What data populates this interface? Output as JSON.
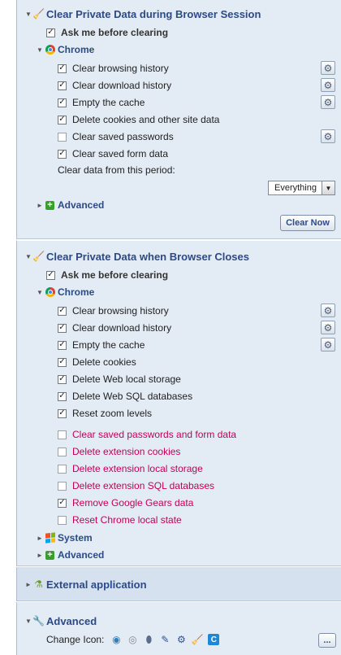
{
  "session": {
    "title": "Clear Private Data during Browser Session",
    "ask_label": "Ask me before clearing",
    "chrome_label": "Chrome",
    "items": [
      {
        "label": "Clear browsing history",
        "checked": true,
        "gear": true
      },
      {
        "label": "Clear download history",
        "checked": true,
        "gear": true
      },
      {
        "label": "Empty the cache",
        "checked": true,
        "gear": true
      },
      {
        "label": "Delete cookies and other site data",
        "checked": true,
        "gear": false
      },
      {
        "label": "Clear saved passwords",
        "checked": false,
        "gear": true
      },
      {
        "label": "Clear saved form data",
        "checked": true,
        "gear": false
      }
    ],
    "period_label": "Clear data from this period:",
    "period_value": "Everything",
    "advanced_label": "Advanced",
    "clear_now_label": "Clear Now"
  },
  "closes": {
    "title": "Clear Private Data when Browser Closes",
    "ask_label": "Ask me before clearing",
    "chrome_label": "Chrome",
    "items": [
      {
        "label": "Clear browsing history",
        "checked": true,
        "gear": true
      },
      {
        "label": "Clear download history",
        "checked": true,
        "gear": true
      },
      {
        "label": "Empty the cache",
        "checked": true,
        "gear": true
      },
      {
        "label": "Delete cookies",
        "checked": true,
        "gear": false
      },
      {
        "label": "Delete Web local storage",
        "checked": true,
        "gear": false
      },
      {
        "label": "Delete Web SQL databases",
        "checked": true,
        "gear": false
      },
      {
        "label": "Reset zoom levels",
        "checked": true,
        "gear": false
      }
    ],
    "extra_items": [
      {
        "label": "Clear saved passwords and form data",
        "checked": false
      },
      {
        "label": "Delete extension cookies",
        "checked": false
      },
      {
        "label": "Delete extension local storage",
        "checked": false
      },
      {
        "label": "Delete extension SQL databases",
        "checked": false
      },
      {
        "label": "Remove Google Gears data",
        "checked": true
      },
      {
        "label": "Reset Chrome local state",
        "checked": false
      }
    ],
    "system_label": "System",
    "advanced_label": "Advanced"
  },
  "external": {
    "title": "External application"
  },
  "advanced": {
    "title": "Advanced",
    "change_icon_label": "Change Icon:",
    "icons": [
      "eraser-blue-icon",
      "eraser-gray-icon",
      "pill-icon",
      "brush-icon",
      "gear-icon",
      "broom-icon",
      "ccleaner-icon"
    ],
    "more_label": "..."
  },
  "colors": {
    "accent": "#2c4a86",
    "red_text": "#c40056",
    "panel_bg": "#e3ebf5"
  }
}
